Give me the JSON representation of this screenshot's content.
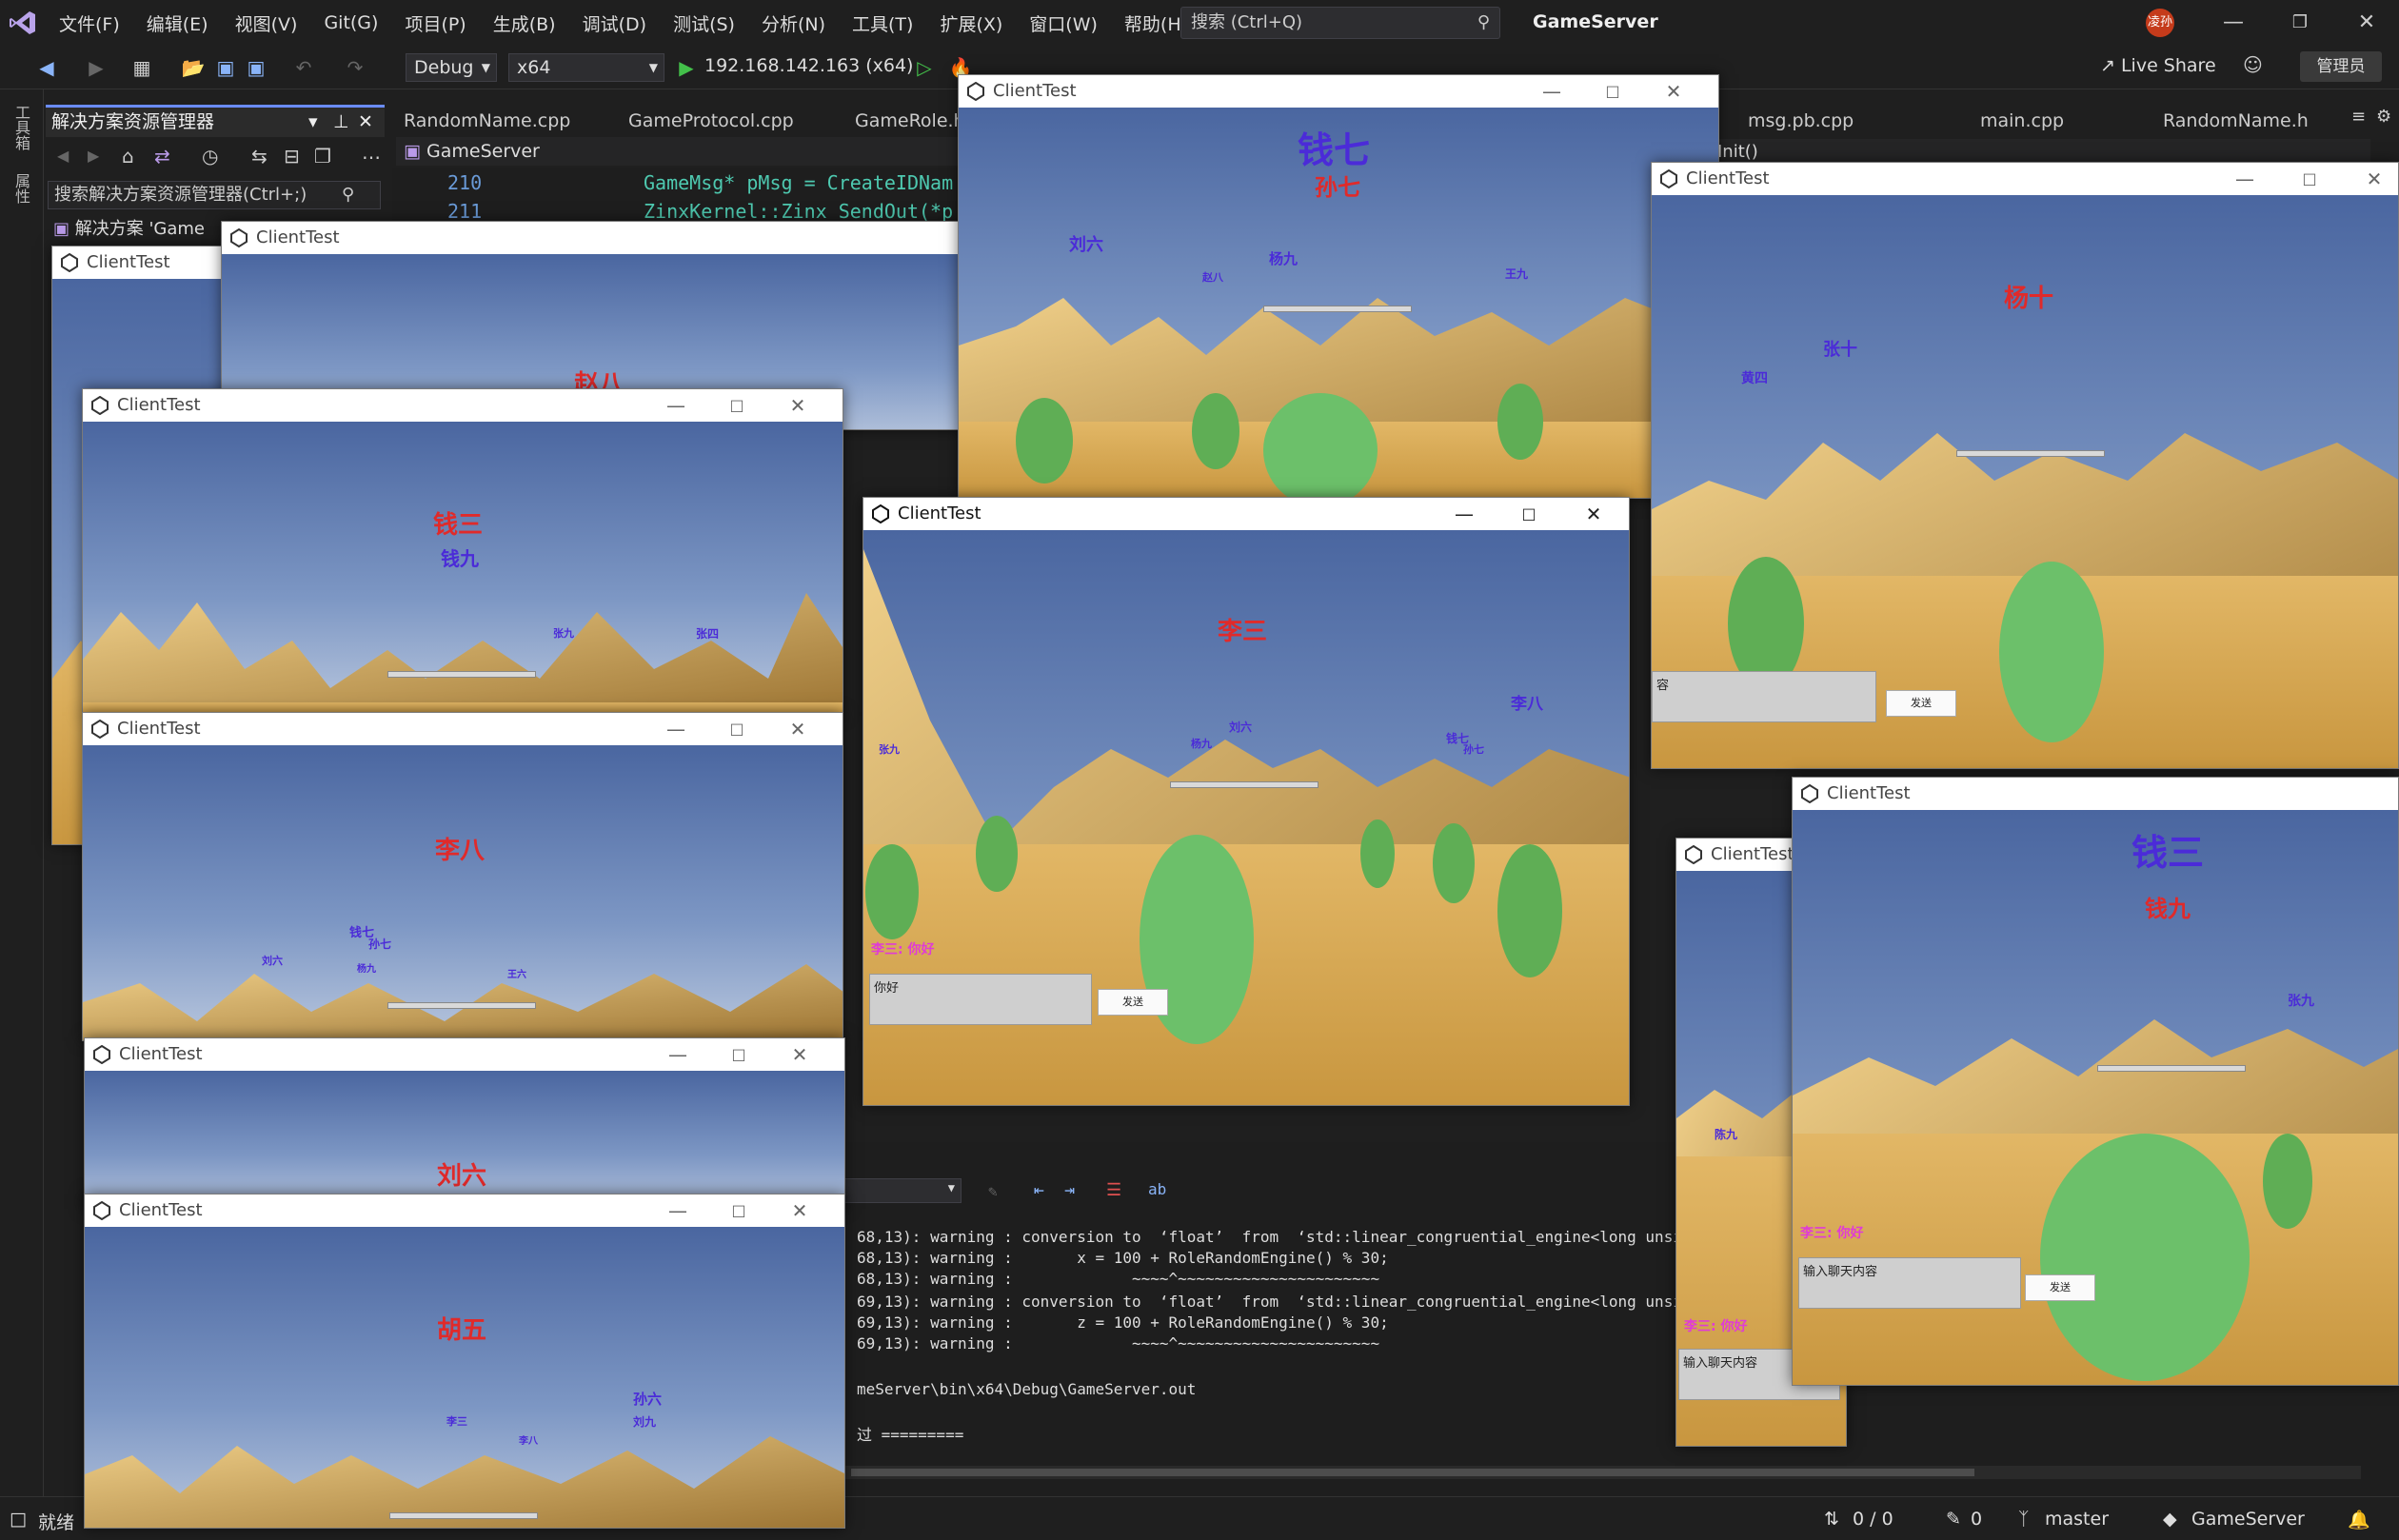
{
  "ide": {
    "menu": [
      "文件(F)",
      "编辑(E)",
      "视图(V)",
      "Git(G)",
      "项目(P)",
      "生成(B)",
      "调试(D)",
      "测试(S)",
      "分析(N)",
      "工具(T)",
      "扩展(X)",
      "窗口(W)",
      "帮助(H)"
    ],
    "search_placeholder": "搜索 (Ctrl+Q)",
    "solution_title": "GameServer",
    "avatar_text": "凌孙",
    "config": "Debug",
    "platform": "x64",
    "run_target": "192.168.142.163 (x64)",
    "live_share": "Live Share",
    "admin": "管理员",
    "left_tools": [
      "工具箱",
      "属性"
    ],
    "solution_explorer": {
      "title": "解决方案资源管理器",
      "search": "搜索解决方案资源管理器(Ctrl+;)",
      "item": "解决方案 'Game"
    },
    "tabs": [
      "RandomName.cpp",
      "GameProtocol.cpp",
      "GameRole.h",
      "msg.pb.cpp",
      "main.cpp",
      "RandomName.h"
    ],
    "breadcrumb": "GameServer",
    "member_crumb": "Init()",
    "code": {
      "lines": [
        {
          "n": "210",
          "text": "GameMsg* pMsg = CreateIDNam"
        },
        {
          "n": "211",
          "text": "ZinxKernel::Zinx_SendOut(*p"
        }
      ]
    },
    "output": [
      "68,13): warning : conversion to  ‘float’  from  ‘std::linear_congruential_engine<long unsigned",
      "68,13): warning :       x = 100 + RoleRandomEngine() % 30;",
      "68,13): warning :             ~~~~^~~~~~~~~~~~~~~~~~~~~~~",
      "69,13): warning : conversion to  ‘float’  from  ‘std::linear_congruential_engine<long unsigned",
      "69,13): warning :       z = 100 + RoleRandomEngine() % 30;",
      "69,13): warning :             ~~~~^~~~~~~~~~~~~~~~~~~~~~~",
      "",
      "meServer\\bin\\x64\\Debug\\GameServer.out",
      "",
      "过 ========="
    ],
    "status": {
      "ready": "就绪",
      "lines": "0 / 0",
      "pencil": "0",
      "branch": "master",
      "repo": "GameServer"
    }
  },
  "client_title": "ClientTest",
  "chat": {
    "send": "发送",
    "placeholder": "输入聊天内容",
    "typed": "你好",
    "msg": "李三: 你好"
  },
  "windows": {
    "w1": {
      "main": "赵八"
    },
    "w2": {
      "main": "钱三",
      "sub": "钱九",
      "others": [
        "张九",
        "张四"
      ]
    },
    "w3": {
      "main": "李八",
      "others": [
        "钱七",
        "孙七",
        "刘六",
        "杨九",
        "王六"
      ]
    },
    "w4": {
      "main": "刘六"
    },
    "w5": {
      "main": "胡五",
      "others": [
        "孙六",
        "刘九",
        "李三",
        "李八"
      ]
    },
    "w6": {
      "main": "钱七",
      "sub": "孙七",
      "others": [
        "刘六",
        "杨九",
        "赵八",
        "王九"
      ]
    },
    "w7": {
      "main": "杨十",
      "others": [
        "张十",
        "黄四"
      ],
      "box": "容"
    },
    "w8": {
      "main": "李三",
      "others": [
        "李八",
        "刘六",
        "杨九",
        "钱七",
        "孙七",
        "张九"
      ]
    },
    "w9": {
      "main": "钱三",
      "sub": "钱九",
      "others": [
        "张九"
      ]
    },
    "w10": {
      "others": [
        "陈九"
      ]
    }
  }
}
